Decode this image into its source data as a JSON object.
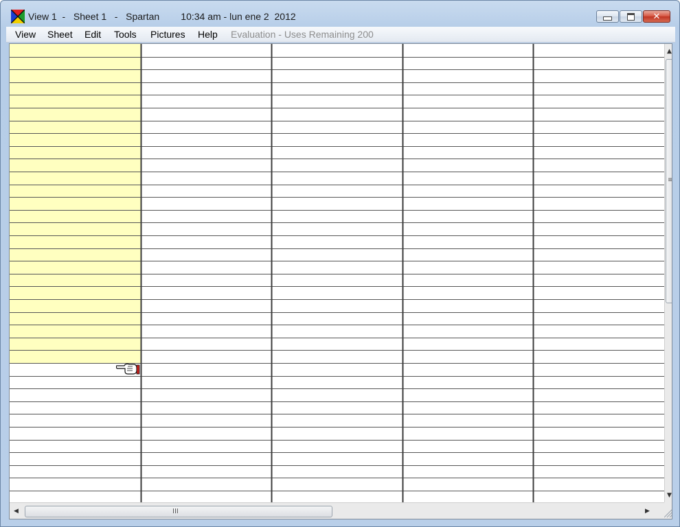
{
  "window": {
    "title": "View 1  -   Sheet 1   -   Spartan        10:34 am - lun ene 2  2012",
    "icons": {
      "app": "spartan-logo-icon",
      "minimize": "minimize-icon",
      "maximize": "maximize-icon",
      "close": "close-icon"
    },
    "close_glyph": "✕"
  },
  "menu": {
    "items": [
      "View",
      "Sheet",
      "Edit",
      "Tools",
      "Pictures",
      "Help"
    ],
    "status": "Evaluation - Uses Remaining 200"
  },
  "sheet": {
    "columns": 5,
    "rows": 36,
    "highlight_column": 0,
    "highlight_rows": 25,
    "highlight_color": "#ffffc0",
    "line_color": "#3c3c3c"
  },
  "scrollbars": {
    "v_grip": "≡",
    "h_grip": "III",
    "up_arrow": "▲",
    "down_arrow": "▼",
    "left_arrow": "◀",
    "right_arrow": "▶"
  },
  "cursor": {
    "icon": "pointing-hand-cursor-icon"
  }
}
